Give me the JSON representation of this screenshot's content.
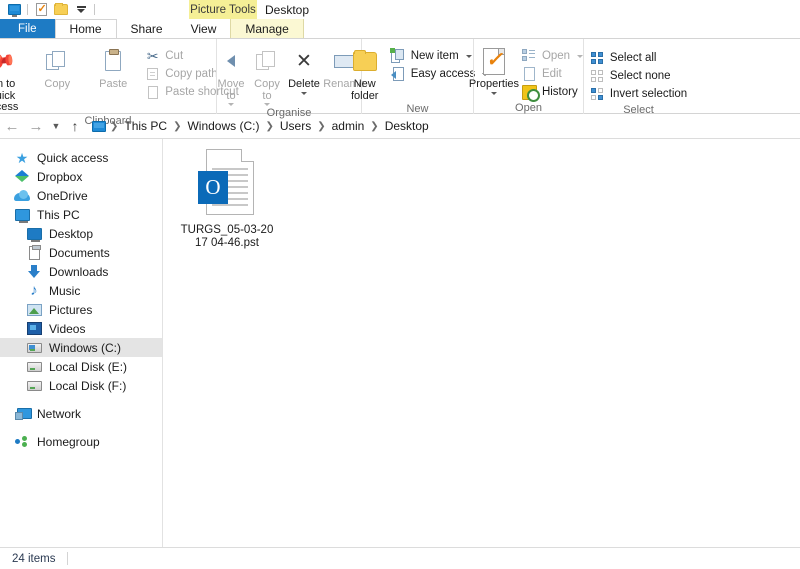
{
  "window": {
    "title": "Desktop",
    "contextual_tab_header": "Picture Tools"
  },
  "quick_access_toolbar": {
    "items": [
      {
        "name": "explorer-icon",
        "label": "File Explorer"
      },
      {
        "name": "properties-icon",
        "label": "Properties"
      },
      {
        "name": "new-folder-icon",
        "label": "New folder"
      },
      {
        "name": "customize-icon",
        "label": "Customize Quick Access Toolbar"
      }
    ]
  },
  "tabs": [
    {
      "label": "File",
      "id": "file",
      "state": "file"
    },
    {
      "label": "Home",
      "id": "home",
      "state": "active"
    },
    {
      "label": "Share",
      "id": "share",
      "state": "normal"
    },
    {
      "label": "View",
      "id": "view",
      "state": "normal"
    },
    {
      "label": "Manage",
      "id": "manage",
      "state": "contextual"
    }
  ],
  "ribbon": {
    "groups": [
      {
        "label": "Clipboard",
        "big_buttons": [
          {
            "label": "Pin to Quick access",
            "icon": "pin-icon",
            "disabled": false
          },
          {
            "label": "Copy",
            "icon": "copy-icon",
            "disabled": true
          },
          {
            "label": "Paste",
            "icon": "paste-icon",
            "disabled": true
          }
        ],
        "small_buttons": [
          {
            "label": "Cut",
            "icon": "scissors-icon",
            "disabled": true,
            "dropdown": false
          },
          {
            "label": "Copy path",
            "icon": "copy-path-icon",
            "disabled": true,
            "dropdown": false
          },
          {
            "label": "Paste shortcut",
            "icon": "paste-shortcut-icon",
            "disabled": true,
            "dropdown": false
          }
        ]
      },
      {
        "label": "Organise",
        "big_buttons": [
          {
            "label": "Move to",
            "icon": "move-to-icon",
            "disabled": true,
            "dropdown": true
          },
          {
            "label": "Copy to",
            "icon": "copy-to-icon",
            "disabled": true,
            "dropdown": true
          },
          {
            "label": "Delete",
            "icon": "delete-icon",
            "disabled": false,
            "dropdown": true
          },
          {
            "label": "Rename",
            "icon": "rename-icon",
            "disabled": true,
            "dropdown": false
          }
        ],
        "small_buttons": []
      },
      {
        "label": "New",
        "big_buttons": [
          {
            "label": "New folder",
            "icon": "new-folder-icon",
            "disabled": false
          }
        ],
        "small_buttons": [
          {
            "label": "New item",
            "icon": "new-item-icon",
            "disabled": false,
            "dropdown": true
          },
          {
            "label": "Easy access",
            "icon": "easy-access-icon",
            "disabled": false,
            "dropdown": true
          }
        ]
      },
      {
        "label": "Open",
        "big_buttons": [
          {
            "label": "Properties",
            "icon": "properties-icon",
            "disabled": false,
            "dropdown": true
          }
        ],
        "small_buttons": [
          {
            "label": "Open",
            "icon": "open-icon",
            "disabled": true,
            "dropdown": true
          },
          {
            "label": "Edit",
            "icon": "edit-icon",
            "disabled": true,
            "dropdown": false
          },
          {
            "label": "History",
            "icon": "history-icon",
            "disabled": false,
            "dropdown": false
          }
        ]
      },
      {
        "label": "Select",
        "big_buttons": [],
        "small_buttons": [
          {
            "label": "Select all",
            "icon": "select-all-icon",
            "disabled": false,
            "dropdown": false
          },
          {
            "label": "Select none",
            "icon": "select-none-icon",
            "disabled": false,
            "dropdown": false
          },
          {
            "label": "Invert selection",
            "icon": "invert-selection-icon",
            "disabled": false,
            "dropdown": false
          }
        ]
      }
    ]
  },
  "address_bar": {
    "back_icon": "back-arrow-icon",
    "forward_icon": "forward-arrow-icon",
    "recent_icon": "recent-locations-icon",
    "up_icon": "up-arrow-icon",
    "breadcrumbs": [
      {
        "label": "This PC"
      },
      {
        "label": "Windows (C:)"
      },
      {
        "label": "Users"
      },
      {
        "label": "admin"
      },
      {
        "label": "Desktop"
      }
    ]
  },
  "sidebar": {
    "items": [
      {
        "label": "Quick access",
        "icon": "star-icon",
        "indent": 0,
        "selected": false
      },
      {
        "label": "Dropbox",
        "icon": "dropbox-icon",
        "indent": 0,
        "selected": false
      },
      {
        "label": "OneDrive",
        "icon": "onedrive-icon",
        "indent": 0,
        "selected": false
      },
      {
        "label": "This PC",
        "icon": "this-pc-icon",
        "indent": 0,
        "selected": false
      },
      {
        "label": "Desktop",
        "icon": "desktop-icon",
        "indent": 1,
        "selected": false
      },
      {
        "label": "Documents",
        "icon": "documents-icon",
        "indent": 1,
        "selected": false
      },
      {
        "label": "Downloads",
        "icon": "downloads-icon",
        "indent": 1,
        "selected": false
      },
      {
        "label": "Music",
        "icon": "music-icon",
        "indent": 1,
        "selected": false
      },
      {
        "label": "Pictures",
        "icon": "pictures-icon",
        "indent": 1,
        "selected": false
      },
      {
        "label": "Videos",
        "icon": "videos-icon",
        "indent": 1,
        "selected": false
      },
      {
        "label": "Windows (C:)",
        "icon": "windows-drive-icon",
        "indent": 1,
        "selected": true
      },
      {
        "label": "Local Disk (E:)",
        "icon": "drive-icon",
        "indent": 1,
        "selected": false
      },
      {
        "label": "Local Disk (F:)",
        "icon": "drive-icon",
        "indent": 1,
        "selected": false
      },
      {
        "label": "Network",
        "icon": "network-icon",
        "indent": 0,
        "selected": false
      },
      {
        "label": "Homegroup",
        "icon": "homegroup-icon",
        "indent": 0,
        "selected": false
      }
    ]
  },
  "content": {
    "files": [
      {
        "name": "TURGS_05-03-2017 04-46.pst",
        "icon": "outlook-pst-icon",
        "badge_letter": "O"
      }
    ]
  },
  "status_bar": {
    "item_count": "24 items"
  },
  "colors": {
    "accent_blue": "#1e7bc4",
    "contextual_yellow": "#f5ef96",
    "selection_grey": "#e4e4e4",
    "outlook_blue": "#0b6ab8",
    "orange_check": "#e8820c"
  }
}
